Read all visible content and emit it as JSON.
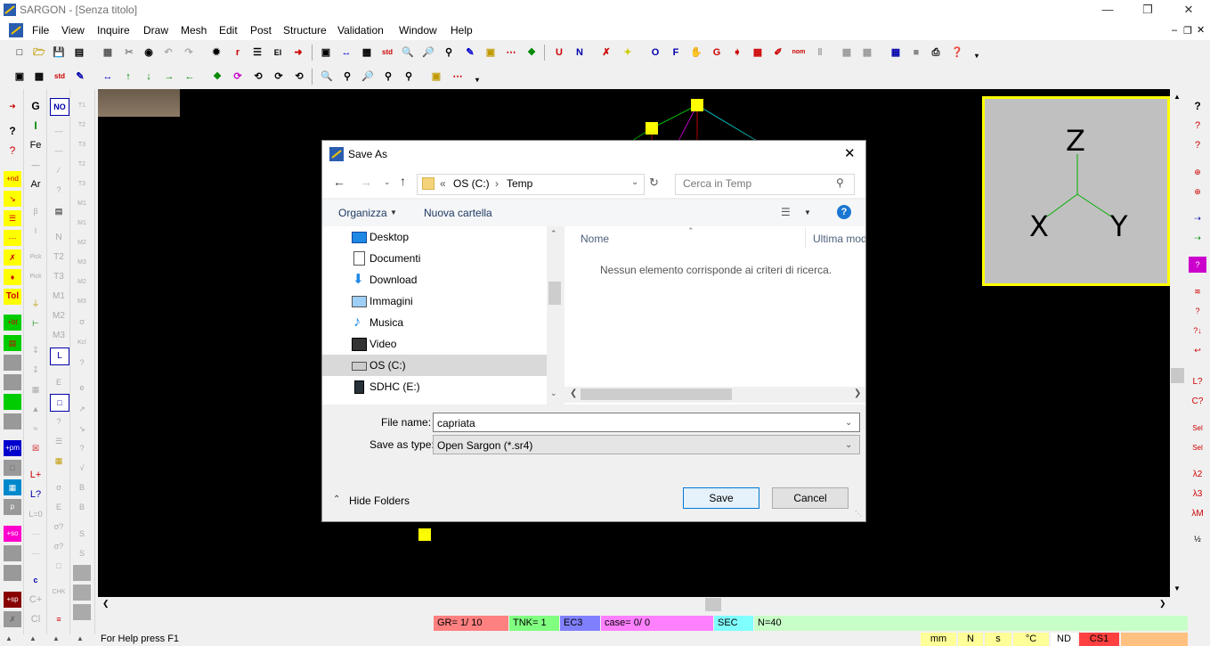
{
  "window": {
    "title": "SARGON - [Senza titolo]"
  },
  "menu": [
    "File",
    "View",
    "Inquire",
    "Draw",
    "Mesh",
    "Edit",
    "Post",
    "Structure",
    "Validation",
    "Window",
    "Help"
  ],
  "toolbar2_letters": {
    "u": "U",
    "n": "N",
    "o": "O",
    "f": "F",
    "g": "G"
  },
  "left_tools": {
    "col2": [
      "G",
      "I",
      "Fe",
      "Ar",
      "?"
    ],
    "col3_top": "NO",
    "col3_l": "L",
    "col1_labels": {
      "nd": "+nd",
      "tol": "Tol",
      "bt": "+bt",
      "pm": "+pm",
      "so": "+so",
      "sp": "+sp"
    },
    "col2_labels": {
      "lplus": "L+",
      "lq": "L?",
      "cplus": "C+",
      "cl": "Cl"
    }
  },
  "axes_widget": {
    "z": "Z",
    "x": "X",
    "y": "Y"
  },
  "dialog": {
    "title": "Save As",
    "breadcrumb": {
      "prefix": "«",
      "drive": "OS (C:)",
      "sep": "›",
      "folder": "Temp"
    },
    "search_placeholder": "Cerca in Temp",
    "organize": "Organizza",
    "new_folder": "Nuova cartella",
    "tree": [
      {
        "label": "Desktop",
        "icon": "desktop-icon"
      },
      {
        "label": "Documenti",
        "icon": "document-icon"
      },
      {
        "label": "Download",
        "icon": "download-icon"
      },
      {
        "label": "Immagini",
        "icon": "picture-icon"
      },
      {
        "label": "Musica",
        "icon": "music-icon"
      },
      {
        "label": "Video",
        "icon": "video-icon"
      },
      {
        "label": "OS (C:)",
        "icon": "drive-icon",
        "selected": true
      },
      {
        "label": "SDHC (E:)",
        "icon": "sdcard-icon"
      }
    ],
    "columns": {
      "name": "Nome",
      "modified": "Ultima mod"
    },
    "empty_message": "Nessun elemento corrisponde ai criteri di ricerca.",
    "file_name_label": "File name:",
    "file_name_value": "capriata",
    "save_type_label": "Save as type:",
    "save_type_value": "Open Sargon (*.sr4)",
    "hide_folders": "Hide Folders",
    "save": "Save",
    "cancel": "Cancel"
  },
  "status": {
    "gr": "GR=  1/ 10",
    "tnk": "TNK= 1",
    "ec": "EC3",
    "case": "case=    0/    0",
    "sec": "SEC",
    "n": "N=40",
    "help": "For Help press F1",
    "units": [
      "mm",
      "N",
      "s",
      "°C",
      "ND",
      "CS1"
    ]
  },
  "right_tools": [
    "?",
    "?",
    "?",
    "L?",
    "C?",
    "Sel",
    "Sel",
    "λ2",
    "λ3",
    "λM"
  ],
  "colors": {
    "canvas": "#000000",
    "node": "#ffff00",
    "axes_border": "#ffff00",
    "axes_bg": "#c0c0c0"
  }
}
